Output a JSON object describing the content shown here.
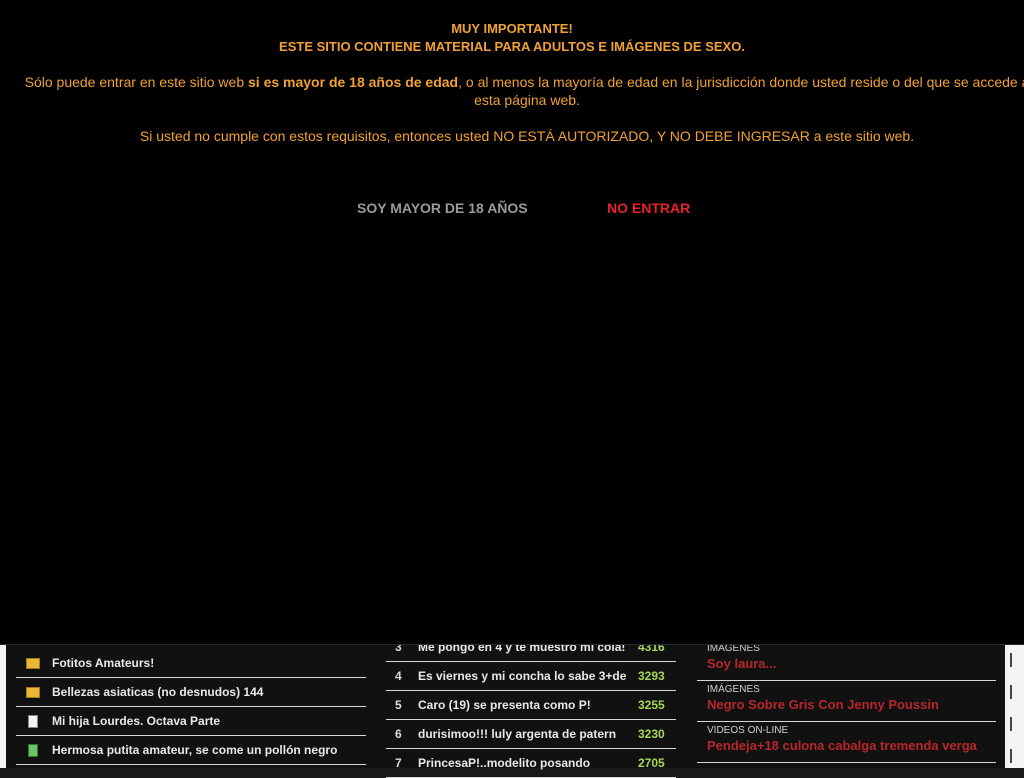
{
  "modal": {
    "title_line1": "MUY IMPORTANTE!",
    "title_line2": "ESTE SITIO CONTIENE MATERIAL PARA ADULTOS E IMÁGENES DE SEXO.",
    "para1_before": "Sólo puede entrar en este sitio web ",
    "para1_bold": "si es mayor de 18 años de edad",
    "para1_after": ", o al menos la mayoría de edad en la jurisdicción donde usted reside o del que se accede a esta página web.",
    "para2": "Si usted no cumple con estos requisitos, entonces usted NO ESTÁ AUTORIZADO, Y NO DEBE INGRESAR a este sitio web.",
    "enter_label": "SOY MAYOR DE 18 AÑOS",
    "leave_label": "NO ENTRAR"
  },
  "left_list": [
    {
      "icon": "folder-icon",
      "label": "Fotitos Amateurs!"
    },
    {
      "icon": "folder-icon",
      "label": "Bellezas asiaticas (no desnudos) 144"
    },
    {
      "icon": "document-icon",
      "label": "Mi hija Lourdes. Octava Parte"
    },
    {
      "icon": "film-icon",
      "label": "Hermosa putita amateur, se come un pollón negro"
    }
  ],
  "mid_list": [
    {
      "rank": "3",
      "title": "Me pongo en 4 y te muestro mi cola!",
      "score": "4316"
    },
    {
      "rank": "4",
      "title": "Es viernes y mi concha lo sabe 3+de",
      "score": "3293"
    },
    {
      "rank": "5",
      "title": "Caro (19) se presenta como P!",
      "score": "3255"
    },
    {
      "rank": "6",
      "title": "durisimoo!!! luly argenta de patern",
      "score": "3230"
    },
    {
      "rank": "7",
      "title": "PrincesaP!..modelito posando",
      "score": "2705"
    }
  ],
  "right_list": [
    {
      "category": "IMÁGENES",
      "title": "Soy laura..."
    },
    {
      "category": "IMÁGENES",
      "title": "Negro Sobre Gris Con Jenny Poussin"
    },
    {
      "category": "VIDEOS ON-LINE",
      "title": "Pendeja+18 culona cabalga tremenda verga"
    }
  ],
  "colors": {
    "warning_text": "#f0a132",
    "enter_button": "#9a9a9a",
    "leave_button": "#e8202a",
    "score": "#a8d65a",
    "link_title": "#b8262b"
  }
}
